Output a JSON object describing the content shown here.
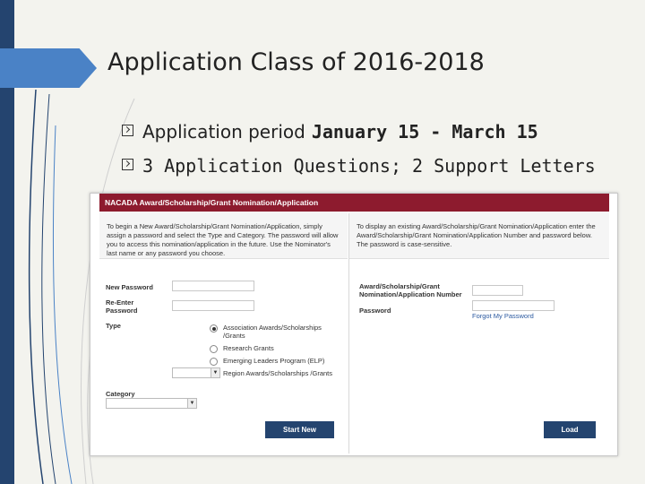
{
  "slide": {
    "title": "Application Class of 2016-2018",
    "bullets": [
      {
        "prefix": "Application period",
        "strong": "January 15 - March 15"
      },
      {
        "text": "3 Application Questions; 2 Support Letters"
      }
    ]
  },
  "form": {
    "header": "NACADA Award/Scholarship/Grant Nomination/Application",
    "new_intro": "To begin a New Award/Scholarship/Grant Nomination/Application, simply assign a password and select the Type and Category. The password will allow you to access this nomination/application in the future. Use the Nominator's last name or any password you choose.",
    "existing_intro": "To display an existing Award/Scholarship/Grant Nomination/Application enter the Award/Scholarship/Grant Nomination/Application Number and password below. The password is case-sensitive.",
    "new_password_label": "New Password",
    "reenter_label": "Re-Enter Password",
    "type_label": "Type",
    "type_options": [
      {
        "label": "Association Awards/Scholarships /Grants",
        "selected": true
      },
      {
        "label": "Research Grants",
        "selected": false
      },
      {
        "label": "Emerging Leaders Program (ELP)",
        "selected": false
      },
      {
        "label": "Region Awards/Scholarships /Grants",
        "selected": false
      }
    ],
    "category_label": "Category",
    "start_button": "Start New",
    "app_number_label": "Award/Scholarship/Grant Nomination/Application Number",
    "password_label": "Password",
    "forgot_link": "Forgot My Password",
    "load_button": "Load"
  },
  "colors": {
    "header_bg": "#8d1b2e",
    "button_bg": "#24446f",
    "accent": "#4a82c6"
  }
}
